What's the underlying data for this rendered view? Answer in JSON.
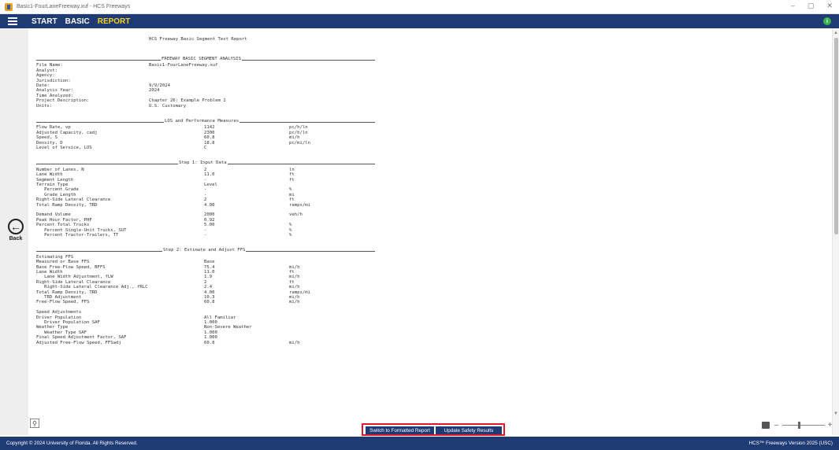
{
  "window": {
    "title": "Basic1-FourLaneFreeway.xuf - HCS Freeways",
    "controls": [
      "–",
      "▢",
      "✕"
    ]
  },
  "menu": {
    "items": [
      {
        "label": "START",
        "active": false
      },
      {
        "label": "BASIC",
        "active": false
      },
      {
        "label": "REPORT",
        "active": true
      }
    ],
    "info_label": "i"
  },
  "sidebar": {
    "back_label": "Back",
    "back_glyph": "←"
  },
  "report": {
    "header": "HCS Freeway Basic Segment Text Report",
    "sections": [
      {
        "title": "FREEWAY BASIC SEGMENT ANALYSIS",
        "rows": [
          {
            "label": "File Name:",
            "value": "Basic1-FourLaneFreeway.xuf",
            "unit": ""
          },
          {
            "label": "Analyst:",
            "value": "",
            "unit": ""
          },
          {
            "label": "Agency:",
            "value": "",
            "unit": ""
          },
          {
            "label": "Jurisdiction:",
            "value": "",
            "unit": ""
          },
          {
            "label": "Date:",
            "value": "9/9/2024",
            "unit": ""
          },
          {
            "label": "Analysis Year:",
            "value": "2024",
            "unit": ""
          },
          {
            "label": "Time Analyzed:",
            "value": "",
            "unit": ""
          },
          {
            "label": "Project Description:",
            "value": "Chapter 26: Example Problem 1",
            "unit": ""
          },
          {
            "label": "Units:",
            "value": "U.S. Customary",
            "unit": ""
          }
        ]
      },
      {
        "title": "LOS and Performance Measures",
        "rows": [
          {
            "label": "Flow Rate, vp",
            "value": "1142",
            "unit": "pc/h/ln"
          },
          {
            "label": "Adjusted Capacity, cadj",
            "value": "2300",
            "unit": "pc/h/ln"
          },
          {
            "label": "Speed, S",
            "value": "60.8",
            "unit": "mi/h"
          },
          {
            "label": "Density, D",
            "value": "18.8",
            "unit": "pc/mi/ln"
          },
          {
            "label": "Level of Service, LOS",
            "value": "C",
            "unit": ""
          }
        ]
      },
      {
        "title": "Step 1: Input Data",
        "rows": [
          {
            "label": "Number of Lanes, N",
            "value": "2",
            "unit": "ln"
          },
          {
            "label": "Lane Width",
            "value": "11.0",
            "unit": "ft"
          },
          {
            "label": "Segment Length",
            "value": "-",
            "unit": "ft"
          },
          {
            "label": "Terrain Type",
            "value": "Level",
            "unit": ""
          },
          {
            "label": "   Percent Grade",
            "value": "-",
            "unit": "%"
          },
          {
            "label": "   Grade Length",
            "value": "-",
            "unit": "mi"
          },
          {
            "label": "Right-Side Lateral Clearance",
            "value": "2",
            "unit": "ft"
          },
          {
            "label": "Total Ramp Density, TRD",
            "value": "4.00",
            "unit": "ramps/mi"
          },
          {
            "label": "",
            "value": "",
            "unit": ""
          },
          {
            "label": "Demand Volume",
            "value": "2000",
            "unit": "veh/h"
          },
          {
            "label": "Peak Hour Factor, PHF",
            "value": "0.92",
            "unit": ""
          },
          {
            "label": "Percent Total Trucks",
            "value": "5.00",
            "unit": "%"
          },
          {
            "label": "   Percent Single-Unit Trucks, SUT",
            "value": "-",
            "unit": "%"
          },
          {
            "label": "   Percent Tractor-Trailers, TT",
            "value": "-",
            "unit": "%"
          }
        ]
      },
      {
        "title": "Step 2: Estimate and Adjust FFS",
        "rows": [
          {
            "label": "Estimating FFS",
            "value": "",
            "unit": ""
          },
          {
            "label": "Measured or Base FFS",
            "value": "Base",
            "unit": ""
          },
          {
            "label": "Base Free-Flow Speed, BFFS",
            "value": "75.4",
            "unit": "mi/h"
          },
          {
            "label": "Lane Width",
            "value": "11.0",
            "unit": "ft"
          },
          {
            "label": "   Lane Width Adjustment, fLW",
            "value": "1.9",
            "unit": "mi/h"
          },
          {
            "label": "Right-Side Lateral Clearance",
            "value": "2",
            "unit": "ft"
          },
          {
            "label": "   Right-Side Lateral Clearance Adj., fRLC",
            "value": "2.4",
            "unit": "mi/h"
          },
          {
            "label": "Total Ramp Density, TRD",
            "value": "4.00",
            "unit": "ramps/mi"
          },
          {
            "label": "   TRD Adjustment",
            "value": "10.3",
            "unit": "mi/h"
          },
          {
            "label": "Free-Flow Speed, FFS",
            "value": "60.8",
            "unit": "mi/h"
          },
          {
            "label": "",
            "value": "",
            "unit": ""
          },
          {
            "label": "Speed Adjustments",
            "value": "",
            "unit": ""
          },
          {
            "label": "Driver Population",
            "value": "All Familiar",
            "unit": ""
          },
          {
            "label": "   Driver Population SAF",
            "value": "1.000",
            "unit": ""
          },
          {
            "label": "Weather Type",
            "value": "Non-Severe Weather",
            "unit": ""
          },
          {
            "label": "   Weather Type SAF",
            "value": "1.000",
            "unit": ""
          },
          {
            "label": "Final Speed Adjustment Factor, SAF",
            "value": "1.000",
            "unit": ""
          },
          {
            "label": "Adjusted Free-Flow Speed, FFSadj",
            "value": "60.8",
            "unit": "mi/h"
          }
        ]
      }
    ]
  },
  "actions": {
    "formatted_label": "Switch to Formatted Report",
    "safety_label": "Update Safety Results"
  },
  "zoom": {
    "minus": "–",
    "plus": "+",
    "level": 0.4
  },
  "footer": {
    "copyright": "Copyright © 2024 University of Florida. All Rights Reserved.",
    "version": "HCS™ Freeways Version 2025 (USC)"
  },
  "colors": {
    "navy": "#1f3b73",
    "active_menu": "#f3d21c",
    "highlight_box": "#e0162b",
    "info_green": "#37b24d"
  }
}
